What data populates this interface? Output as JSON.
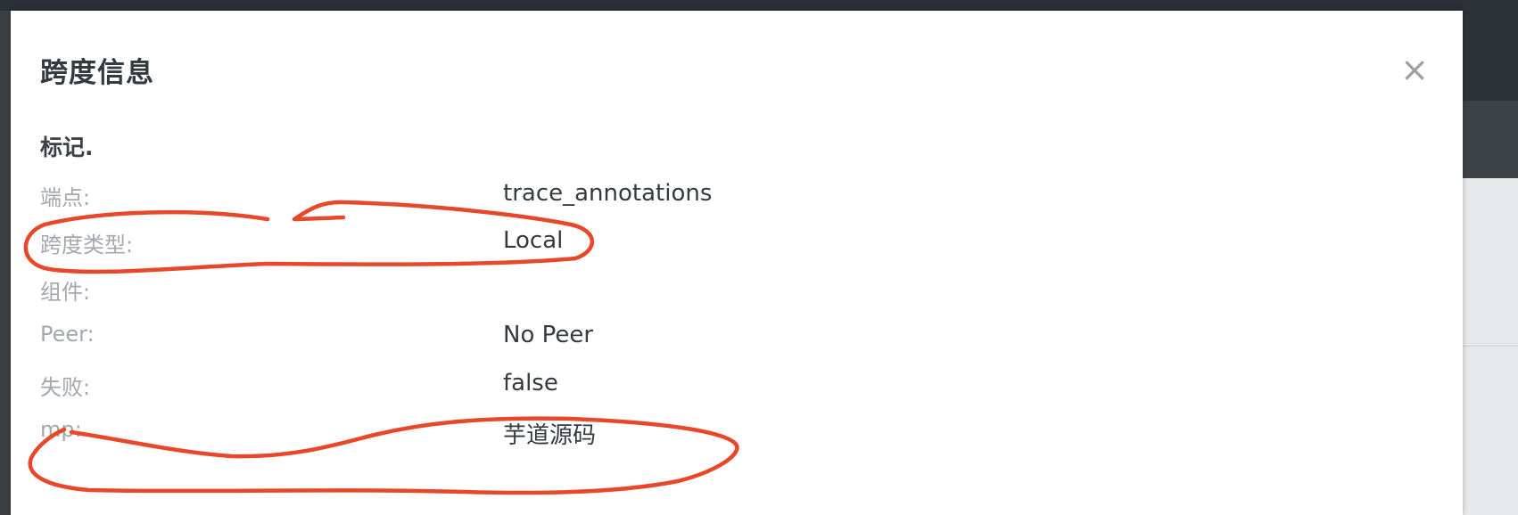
{
  "modal": {
    "title": "跨度信息",
    "close_glyph": "×",
    "section_title": "标记.",
    "rows": [
      {
        "label": "端点:",
        "value": "trace_annotations"
      },
      {
        "label": "跨度类型:",
        "value": "Local"
      },
      {
        "label": "组件:",
        "value": ""
      },
      {
        "label": "Peer:",
        "value": "No Peer"
      },
      {
        "label": "失败:",
        "value": "false"
      },
      {
        "label": "mp:",
        "value": "芋道源码"
      }
    ]
  },
  "colors": {
    "annotation": "#e8472a",
    "label": "#a3a8ae",
    "value": "#333a40"
  },
  "icons": {
    "close": "close-icon"
  }
}
